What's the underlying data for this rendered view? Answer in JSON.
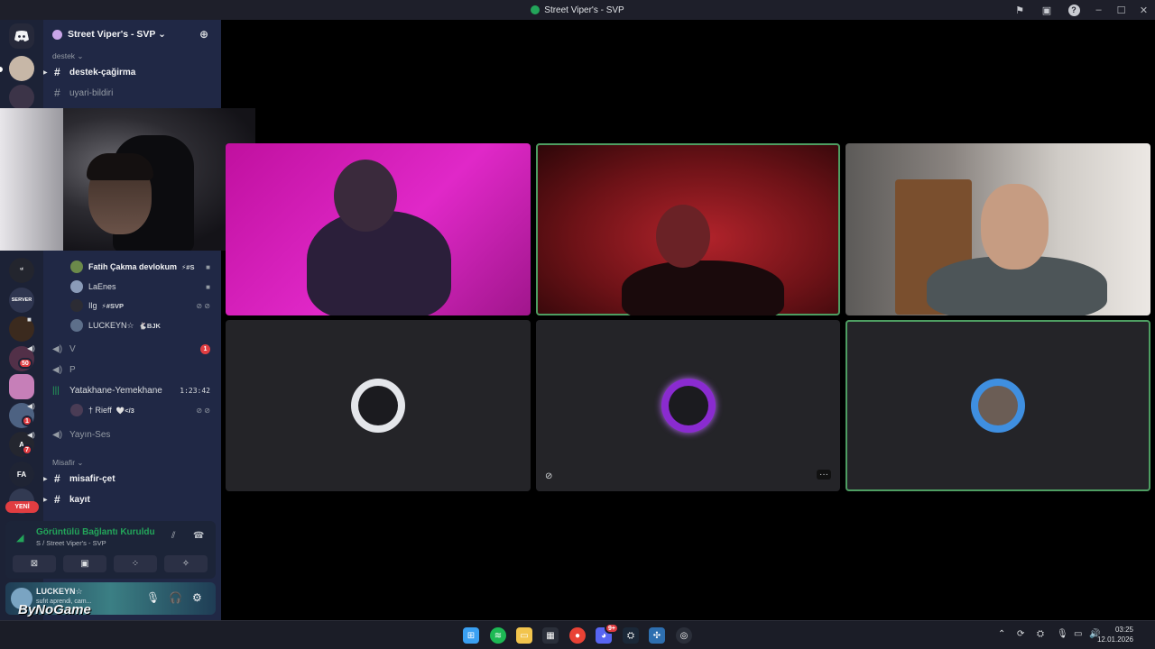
{
  "window": {
    "title": "Street Viper's - SVP",
    "controls": {
      "minimize": "–",
      "maximize": "☐",
      "close": "✕"
    }
  },
  "server": {
    "name": "Street Viper's - SVP ⌄",
    "rail_badges": [
      "50",
      "1",
      "7"
    ]
  },
  "categories": {
    "destek": "destek ⌄",
    "misafir": "Misafir ⌄"
  },
  "channels": {
    "destek_cagirma": "destek-çağirma",
    "uyari_bildiri": "uyari-bildiri",
    "v": "V",
    "v_badge": "1",
    "p": "P",
    "yatakhane": "Yatakhane-Yemekhane",
    "yatakhane_timer": "1:23:42",
    "yayin_ses": "Yayın-Ses",
    "misafir_cet": "misafir-çet",
    "kayit": "kayıt"
  },
  "voice_users": [
    {
      "name": "Fatih Çakma devlokum",
      "tag": "⚡#S"
    },
    {
      "name": "LaEnes",
      "tag": ""
    },
    {
      "name": "Ilg",
      "tag": "⚡#SVP"
    },
    {
      "name": "LUCKEYN☆",
      "tag": "🐇BJK"
    }
  ],
  "yatakhane_user": {
    "name": "† Rieff",
    "tag": "🤍</3"
  },
  "new_pill": "YENİ",
  "voice_panel": {
    "status": "Görüntülü Bağlantı Kuruldu",
    "location": "S / Street Viper's - SVP"
  },
  "user_panel": {
    "name": "LUCKEYN☆",
    "status": "sufıt aprendi, cam..."
  },
  "watermark": "ByNoGame",
  "taskbar": {
    "time": "03:25",
    "date": "12.01.2026",
    "discord_badge": "9+"
  },
  "colors": {
    "speaking_outline": "#4e9e62",
    "connected_green": "#23a55a",
    "notification_red": "#e13d41",
    "sidebar_bg": "#202845"
  },
  "icons": [
    "flag-icon",
    "screen-icon",
    "help-icon",
    "add-member-icon",
    "hash-icon",
    "speaker-icon",
    "camera-icon",
    "mute-icon",
    "deafen-icon",
    "signal-icon",
    "hangup-icon",
    "mic-icon",
    "headphones-icon",
    "gear-icon",
    "more-icon"
  ]
}
